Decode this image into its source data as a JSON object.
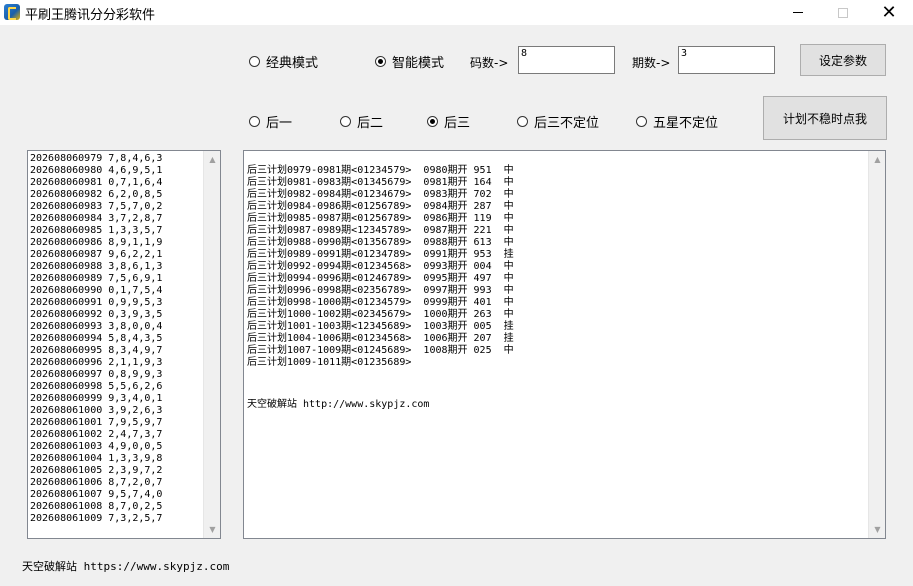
{
  "window": {
    "title": "平刷王腾讯分分彩软件",
    "minimize_glyph": "—",
    "maximize_glyph": "☐",
    "close_glyph": "✕"
  },
  "mode_options": [
    {
      "label": "经典模式",
      "checked": false
    },
    {
      "label": "智能模式",
      "checked": true
    }
  ],
  "params": {
    "code_count_label": "码数->",
    "code_count_value": "8",
    "period_count_label": "期数->",
    "period_count_value": "3",
    "set_button_label": "设定参数"
  },
  "position_options": [
    {
      "label": "后一",
      "checked": false
    },
    {
      "label": "后二",
      "checked": false
    },
    {
      "label": "后三",
      "checked": true
    },
    {
      "label": "后三不定位",
      "checked": false
    },
    {
      "label": "五星不定位",
      "checked": false
    }
  ],
  "unstable_button_label": "计划不稳时点我",
  "history": [
    "202608060979 7,8,4,6,3",
    "202608060980 4,6,9,5,1",
    "202608060981 0,7,1,6,4",
    "202608060982 6,2,0,8,5",
    "202608060983 7,5,7,0,2",
    "202608060984 3,7,2,8,7",
    "202608060985 1,3,3,5,7",
    "202608060986 8,9,1,1,9",
    "202608060987 9,6,2,2,1",
    "202608060988 3,8,6,1,3",
    "202608060989 7,5,6,9,1",
    "202608060990 0,1,7,5,4",
    "202608060991 0,9,9,5,3",
    "202608060992 0,3,9,3,5",
    "202608060993 3,8,0,0,4",
    "202608060994 5,8,4,3,5",
    "202608060995 8,3,4,9,7",
    "202608060996 2,1,1,9,3",
    "202608060997 0,8,9,9,3",
    "202608060998 5,5,6,2,6",
    "202608060999 9,3,4,0,1",
    "202608061000 3,9,2,6,3",
    "202608061001 7,9,5,9,7",
    "202608061002 2,4,7,3,7",
    "202608061003 4,9,0,0,5",
    "202608061004 1,3,3,9,8",
    "202608061005 2,3,9,7,2",
    "202608061006 8,7,2,0,7",
    "202608061007 9,5,7,4,0",
    "202608061008 8,7,0,2,5",
    "202608061009 7,3,2,5,7"
  ],
  "plans": [
    "后三计划0979-0981期<01234579>  0980期开 951  中",
    "后三计划0981-0983期<01345679>  0981期开 164  中",
    "后三计划0982-0984期<01234679>  0983期开 702  中",
    "后三计划0984-0986期<01256789>  0984期开 287  中",
    "后三计划0985-0987期<01256789>  0986期开 119  中",
    "后三计划0987-0989期<12345789>  0987期开 221  中",
    "后三计划0988-0990期<01356789>  0988期开 613  中",
    "后三计划0989-0991期<01234789>  0991期开 953  挂",
    "后三计划0992-0994期<01234568>  0993期开 004  中",
    "后三计划0994-0996期<01246789>  0995期开 497  中",
    "后三计划0996-0998期<02356789>  0997期开 993  中",
    "后三计划0998-1000期<01234579>  0999期开 401  中",
    "后三计划1000-1002期<02345679>  1000期开 263  中",
    "后三计划1001-1003期<12345689>  1003期开 005  挂",
    "后三计划1004-1006期<01234568>  1006期开 207  挂",
    "后三计划1007-1009期<01245689>  1008期开 025  中",
    "后三计划1009-1011期<01235689>"
  ],
  "plan_watermark": "天空破解站 http://www.skypjz.com",
  "footer_text": "天空破解站 https://www.skypjz.com",
  "scroll": {
    "up_glyph": "▲",
    "down_glyph": "▼"
  }
}
